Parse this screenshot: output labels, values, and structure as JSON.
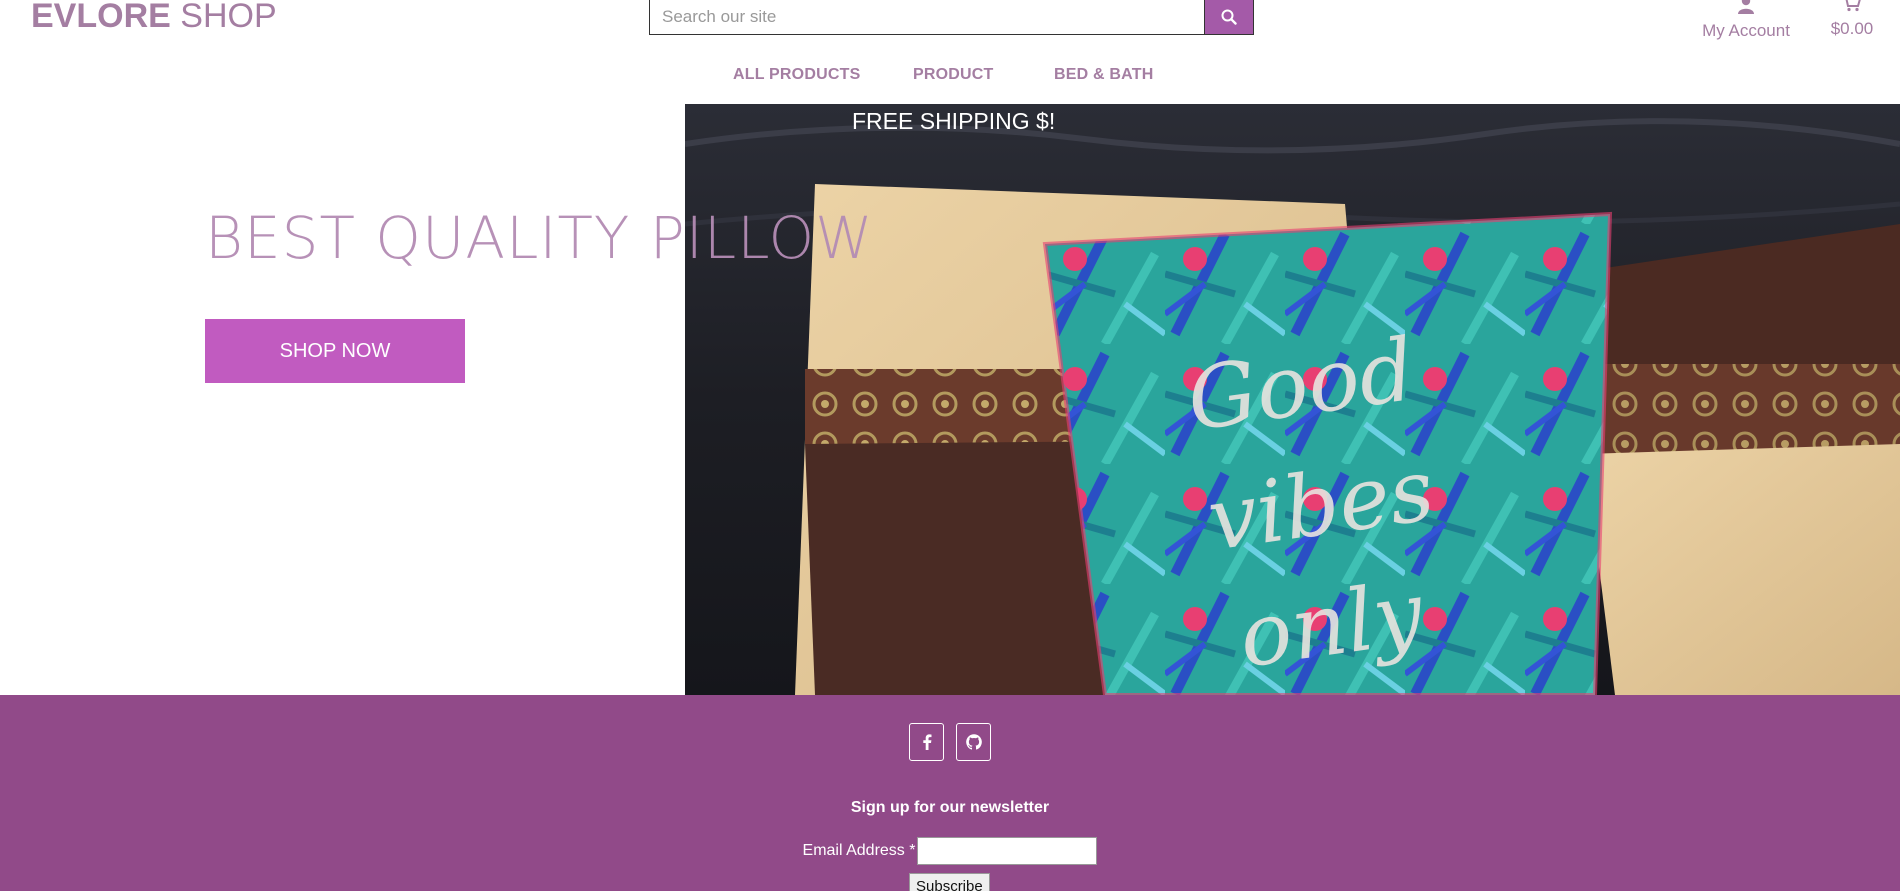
{
  "header": {
    "brand": "EVLORE",
    "brand_suffix": "SHOP",
    "search_placeholder": "Search our site",
    "account_label": "My Account",
    "cart_total": "$0.00"
  },
  "nav": {
    "items": [
      {
        "label": "ALL PRODUCTS"
      },
      {
        "label": "PRODUCT"
      },
      {
        "label": "BED & BATH"
      }
    ]
  },
  "hero": {
    "banner_text": "FREE SHIPPING $!",
    "title": "BEST QUALITY PILLOW",
    "cta_label": "SHOP NOW"
  },
  "footer": {
    "newsletter_title": "Sign up for our newsletter",
    "email_label": "Email Address *",
    "subscribe_label": "Subscribe",
    "social": [
      "facebook-icon",
      "github-icon"
    ]
  },
  "colors": {
    "accent": "#a45aa8",
    "brand_text": "#a47ea2",
    "cta": "#c15bc0",
    "footer_bg": "#914a89"
  },
  "icons": {
    "search": "search-icon",
    "account": "user-icon",
    "cart": "cart-icon"
  }
}
